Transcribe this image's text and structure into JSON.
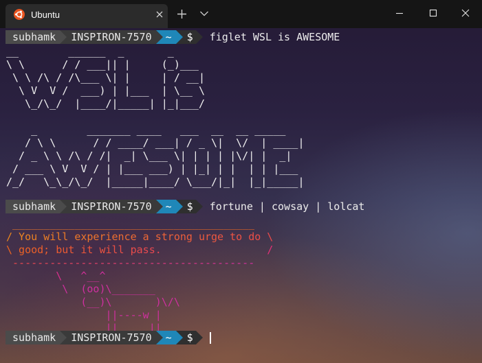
{
  "window": {
    "tab_title": "Ubuntu",
    "tab_icon": "ubuntu-logo-icon",
    "colors": {
      "titlebar": "#151515",
      "tab": "#2b2b2b",
      "ubuntu_orange": "#e95420"
    }
  },
  "prompt": {
    "user": "subhamk",
    "host": "INSPIRON-7570",
    "dir": "~",
    "symbol": "$",
    "colors": {
      "user_bg": "#4b4b4b",
      "host_bg": "#3a3a3a",
      "dir_bg": "#1f87b8"
    }
  },
  "commands": [
    "figlet WSL is AWESOME",
    "fortune | cowsay | lolcat",
    ""
  ],
  "figlet_lines": [
    "__        ______  _       _",
    "\\ \\      / / ___|| |     (_)___",
    " \\ \\ /\\ / /\\___ \\| |     | / __|",
    "  \\ V  V /  ___) | |___  | \\__ \\",
    "   \\_/\\_/  |____/|_____| |_|___/",
    "",
    "    _        _______ ____   ___  __  __ _____",
    "   / \\ \\      / / ____/ ___| / _ \\|  \\/  | ____|",
    "  / _ \\ \\ /\\ / /|  _| \\___ \\| | | | |\\/| |  _|",
    " / ___ \\ V  V / | |___ ___) | |_| | |  | | |___",
    "/_/   \\_\\_/\\_/  |_____|____/ \\___/|_|  |_|_____|"
  ],
  "cowsay_lines": [
    " _______________________________________",
    "/ You will experience a strong urge to do \\",
    "\\ good; but it will pass.                 /",
    " ---------------------------------------",
    "        \\   ^__^",
    "         \\  (oo)\\_______",
    "            (__)\\       )\\/\\",
    "                ||----w |",
    "                ||     ||"
  ],
  "lolcat_colors": [
    "#e8762c",
    "#f08a1c",
    "#f0661e",
    "#ef4a4a",
    "#e6307a",
    "#d02fa0"
  ]
}
